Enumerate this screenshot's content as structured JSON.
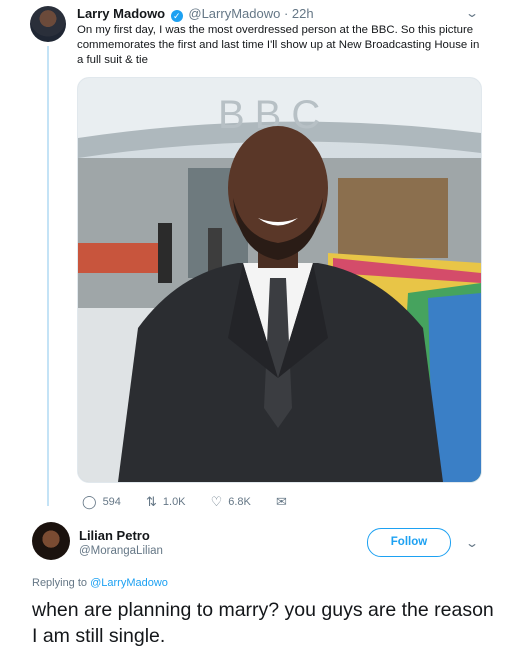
{
  "original_tweet": {
    "name": "Larry Madowo",
    "verified_mark": "✓",
    "handle": "@LarryMadowo",
    "separator": "·",
    "time": "22h",
    "text": "On my first day, I was the most overdressed person at the BBC. So this picture commemorates the first and last time I'll show up at New Broadcasting House in a full suit & tie",
    "photo_sign": "BBC",
    "actions": {
      "replies": "594",
      "retweets": "1.0K",
      "likes": "6.8K"
    }
  },
  "reply": {
    "name": "Lilian Petro",
    "handle": "@MorangaLilian",
    "follow_label": "Follow",
    "replying_to_prefix": "Replying to ",
    "replying_to_handle": "@LarryMadowo",
    "text": "when are planning to marry? you guys are the reason I am still single."
  },
  "icons": {
    "reply": "reply-icon",
    "retweet": "retweet-icon",
    "like": "heart-icon",
    "message": "envelope-icon",
    "more": "chevron-down-icon"
  },
  "colors": {
    "accent": "#1da1f2",
    "muted": "#657786",
    "thread_line": "#c4e3f6"
  }
}
